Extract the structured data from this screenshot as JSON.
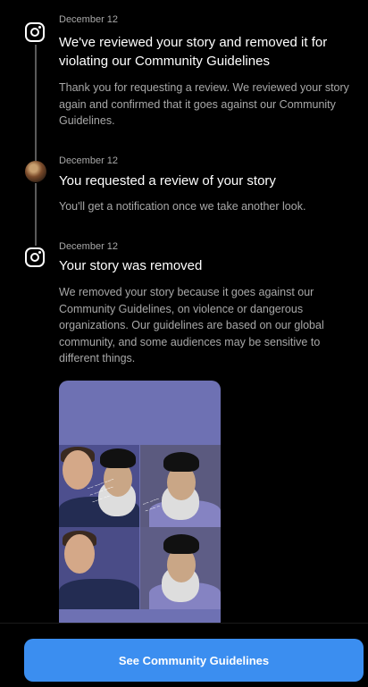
{
  "notifications": [
    {
      "icon": "instagram-icon",
      "date": "December 12",
      "title": "We've reviewed your story and removed it for violating our Community Guidelines",
      "body": "Thank you for requesting a review. We reviewed your story again and confirmed that it goes against our Community Guidelines."
    },
    {
      "icon": "user-avatar",
      "date": "December 12",
      "title": "You requested a review of your story",
      "body": "You'll get a notification once we take another look."
    },
    {
      "icon": "instagram-icon",
      "date": "December 12",
      "title": "Your story was removed",
      "body": "We removed your story because it goes against our Community Guidelines, on violence or dangerous organizations. Our guidelines are based on our global community, and some audiences may be sensitive to different things."
    }
  ],
  "cta": {
    "label": "See Community Guidelines"
  },
  "colors": {
    "accent": "#3b8ef0",
    "background": "#000000",
    "secondary_text": "#a8a8a8"
  }
}
